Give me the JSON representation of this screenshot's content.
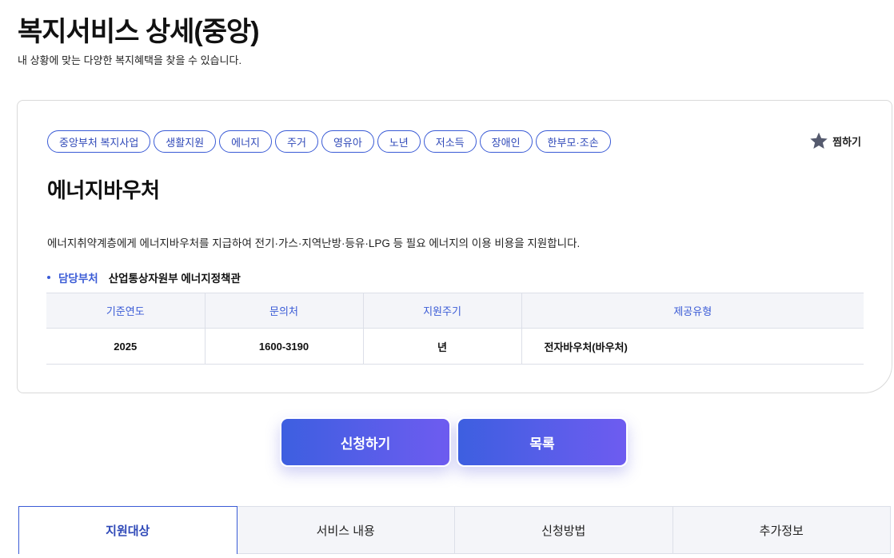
{
  "header": {
    "title": "복지서비스 상세(중앙)",
    "subtitle": "내 상황에 맞는 다양한 복지혜택을 찾을 수 있습니다."
  },
  "service": {
    "tags": [
      "중앙부처 복지사업",
      "생활지원",
      "에너지",
      "주거",
      "영유아",
      "노년",
      "저소득",
      "장애인",
      "한부모·조손"
    ],
    "favorite_label": "찜하기",
    "title": "에너지바우처",
    "description": "에너지취약계층에게 에너지바우처를 지급하여 전기·가스·지역난방·등유·LPG 등 필요 에너지의 이용 비용을 지원합니다.",
    "department_label": "담당부처",
    "department_value": "산업통상자원부 에너지정책관",
    "table": {
      "headers": [
        "기준연도",
        "문의처",
        "지원주기",
        "제공유형"
      ],
      "row": [
        "2025",
        "1600-3190",
        "년",
        "전자바우처(바우처)"
      ]
    }
  },
  "actions": {
    "apply_label": "신청하기",
    "list_label": "목록"
  },
  "tabs": [
    "지원대상",
    "서비스 내용",
    "신청방법",
    "추가정보"
  ],
  "colors": {
    "accent": "#3a5bd6",
    "button_gradient_start": "#3d5fe0",
    "button_gradient_end": "#6e5cf0"
  }
}
